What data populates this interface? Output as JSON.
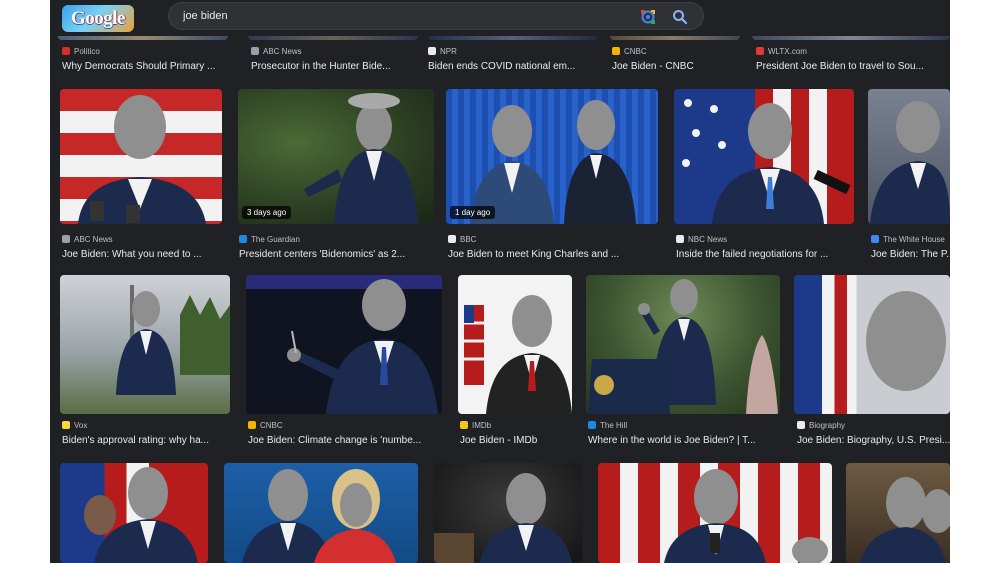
{
  "search": {
    "query": "joe biden"
  },
  "logo": {
    "text": "Google"
  },
  "row0": [
    {
      "source": "Politico",
      "fav": "#d32f2f",
      "title": "Why Democrats Should Primary ..."
    },
    {
      "source": "ABC News",
      "fav": "#9aa0a6",
      "title": "Prosecutor in the Hunter Bide..."
    },
    {
      "source": "NPR",
      "fav": "#e8eaed",
      "title": "Biden ends COVID national em..."
    },
    {
      "source": "CNBC",
      "fav": "#f4b400",
      "title": "Joe Biden - CNBC"
    },
    {
      "source": "WLTX.com",
      "fav": "#e53935",
      "title": "President Joe Biden to travel to Sou..."
    }
  ],
  "row1": [
    {
      "source": "ABC News",
      "fav": "#9aa0a6",
      "title": "Joe Biden: What you need to ...",
      "badge": ""
    },
    {
      "source": "The Guardian",
      "fav": "#1e88e5",
      "title": "President centers 'Bidenomics' as 2...",
      "badge": "3 days ago"
    },
    {
      "source": "BBC",
      "fav": "#e8eaed",
      "title": "Joe Biden to meet King Charles and ...",
      "badge": "1 day ago"
    },
    {
      "source": "NBC News",
      "fav": "#e8eaed",
      "title": "Inside the failed negotiations for ...",
      "badge": ""
    },
    {
      "source": "The White House",
      "fav": "#4285f4",
      "title": "Joe Biden: The P...",
      "badge": ""
    }
  ],
  "row2": [
    {
      "source": "Vox",
      "fav": "#fdd835",
      "title": "Biden's approval rating: why ha..."
    },
    {
      "source": "CNBC",
      "fav": "#f4b400",
      "title": "Joe Biden: Climate change is 'numbe..."
    },
    {
      "source": "IMDb",
      "fav": "#f5c518",
      "title": "Joe Biden - IMDb"
    },
    {
      "source": "The Hill",
      "fav": "#1e88e5",
      "title": "Where in the world is Joe Biden? | T..."
    },
    {
      "source": "Biography",
      "fav": "#e8eaed",
      "title": "Joe Biden: Biography, U.S. Presi..."
    }
  ],
  "icons": {
    "lens": "google-lens-icon",
    "search": "search-icon"
  },
  "colors": {
    "background": "#202124",
    "text": "#e8eaed",
    "subtext": "#bdc1c6",
    "searchbar": "#303134"
  }
}
